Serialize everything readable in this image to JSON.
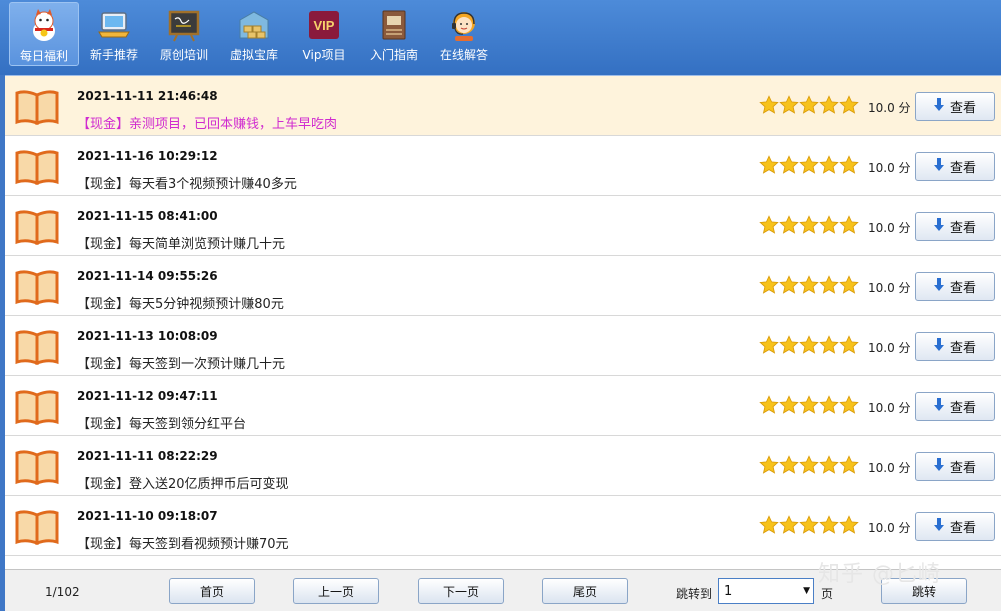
{
  "nav": {
    "items": [
      {
        "label": "每日福利",
        "icon": "lucky-cat-icon",
        "active": true
      },
      {
        "label": "新手推荐",
        "icon": "laptop-icon"
      },
      {
        "label": "原创培训",
        "icon": "chalkboard-icon"
      },
      {
        "label": "虚拟宝库",
        "icon": "warehouse-icon"
      },
      {
        "label": "Vip项目",
        "icon": "vip-icon",
        "icon_text": "VIP"
      },
      {
        "label": "入门指南",
        "icon": "guide-book-icon"
      },
      {
        "label": "在线解答",
        "icon": "support-agent-icon"
      }
    ]
  },
  "list": {
    "rows": [
      {
        "date": "2021-11-11 21:46:48",
        "title": "【现金】亲测项目，已回本赚钱，上车早吃肉",
        "score": "10.0 分",
        "button": "查看",
        "highlight": true
      },
      {
        "date": "2021-11-16 10:29:12",
        "title": "【现金】每天看3个视频预计赚40多元",
        "score": "10.0 分",
        "button": "查看"
      },
      {
        "date": "2021-11-15 08:41:00",
        "title": "【现金】每天简单浏览预计赚几十元",
        "score": "10.0 分",
        "button": "查看"
      },
      {
        "date": "2021-11-14 09:55:26",
        "title": "【现金】每天5分钟视频预计赚80元",
        "score": "10.0 分",
        "button": "查看"
      },
      {
        "date": "2021-11-13 10:08:09",
        "title": "【现金】每天签到一次预计赚几十元",
        "score": "10.0 分",
        "button": "查看"
      },
      {
        "date": "2021-11-12 09:47:11",
        "title": "【现金】每天签到领分红平台",
        "score": "10.0 分",
        "button": "查看"
      },
      {
        "date": "2021-11-11 08:22:29",
        "title": "【现金】登入送20亿质押币后可变现",
        "score": "10.0 分",
        "button": "查看"
      },
      {
        "date": "2021-11-10 09:18:07",
        "title": "【现金】每天签到看视频预计赚70元",
        "score": "10.0 分",
        "button": "查看"
      }
    ],
    "stars_per_row": 5
  },
  "pager": {
    "page_info": "1/102",
    "first": "首页",
    "prev": "上一页",
    "next": "下一页",
    "last": "尾页",
    "jump_label": "跳转到",
    "jump_value": "1",
    "page_unit": "页",
    "jump_button": "跳转"
  },
  "watermark": "知乎 @匕崎",
  "colors": {
    "top_bar": "#3f77c6",
    "highlight_row": "#fef3dc",
    "highlight_title": "#d02bd0",
    "star": "#f7c21b"
  }
}
